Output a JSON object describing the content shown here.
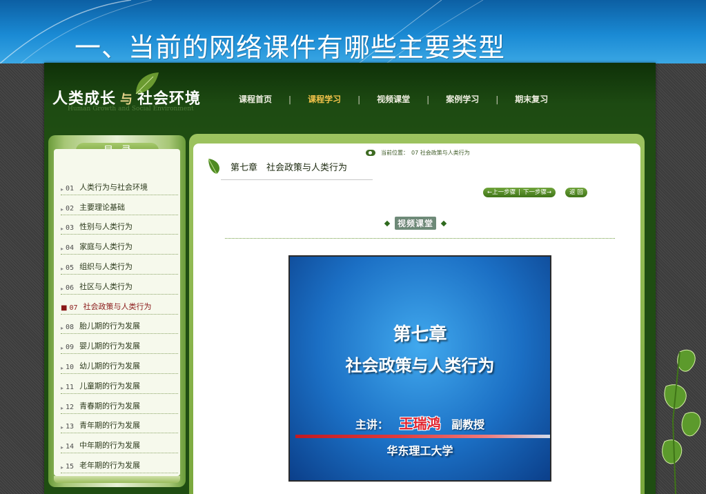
{
  "slide": {
    "title": "一、当前的网络课件有哪些主要类型"
  },
  "site": {
    "logo": {
      "part1": "人类成长",
      "conj": "与",
      "part2": "社会环境",
      "subtitle": "Human Growth and Social Environment"
    },
    "nav": [
      {
        "label": "课程首页",
        "active": false
      },
      {
        "label": "课程学习",
        "active": true
      },
      {
        "label": "视频课堂",
        "active": false
      },
      {
        "label": "案例学习",
        "active": false
      },
      {
        "label": "期末复习",
        "active": false
      }
    ],
    "nav_separator": "|",
    "toc": {
      "title": "目录",
      "items": [
        {
          "num": "01",
          "label": "人类行为与社会环境"
        },
        {
          "num": "02",
          "label": "主要理论基础"
        },
        {
          "num": "03",
          "label": "性别与人类行为"
        },
        {
          "num": "04",
          "label": "家庭与人类行为"
        },
        {
          "num": "05",
          "label": "组织与人类行为"
        },
        {
          "num": "06",
          "label": "社区与人类行为"
        },
        {
          "num": "07",
          "label": "社会政策与人类行为",
          "active": true
        },
        {
          "num": "08",
          "label": "胎儿期的行为发展"
        },
        {
          "num": "09",
          "label": "婴儿期的行为发展"
        },
        {
          "num": "10",
          "label": "幼儿期的行为发展"
        },
        {
          "num": "11",
          "label": "儿童期的行为发展"
        },
        {
          "num": "12",
          "label": "青春期的行为发展"
        },
        {
          "num": "13",
          "label": "青年期的行为发展"
        },
        {
          "num": "14",
          "label": "中年期的行为发展"
        },
        {
          "num": "15",
          "label": "老年期的行为发展"
        }
      ]
    },
    "location": {
      "label": "当前位置：",
      "value": "07  社会政策与人类行为"
    },
    "chapter_title": "第七章　社会政策与人类行为",
    "buttons": {
      "prev": "←上一步骤",
      "next": "下一步骤→",
      "back": "返 回"
    },
    "section_title": "视频课堂",
    "video": {
      "line1": "第七章",
      "line2": "社会政策与人类行为",
      "lecturer_prefix": "主讲：",
      "lecturer_name": "王瑞鸿",
      "lecturer_title": "副教授",
      "university": "华东理工大学"
    }
  },
  "colors": {
    "slide_blue": "#1a8ad4",
    "site_green": "#1f4d12",
    "active_nav": "#f2c24a",
    "active_toc": "#8a1818"
  }
}
